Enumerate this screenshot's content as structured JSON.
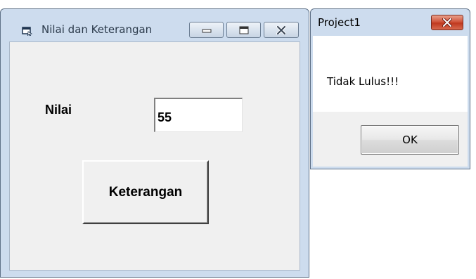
{
  "main_window": {
    "title": "Nilai dan Keterangan",
    "label_nilai": "Nilai",
    "input_nilai_value": "55",
    "button_keterangan": "Keterangan",
    "app_icon": "vb-form-icon",
    "caption_buttons": [
      "minimize-icon",
      "maximize-icon",
      "close-icon"
    ]
  },
  "message_box": {
    "title": "Project1",
    "message": "Tidak Lulus!!!",
    "ok_label": "OK",
    "close_icon": "close-icon"
  },
  "colors": {
    "frame": "#cddcee",
    "client": "#f0f0f0",
    "close_red": "#c0391f"
  }
}
